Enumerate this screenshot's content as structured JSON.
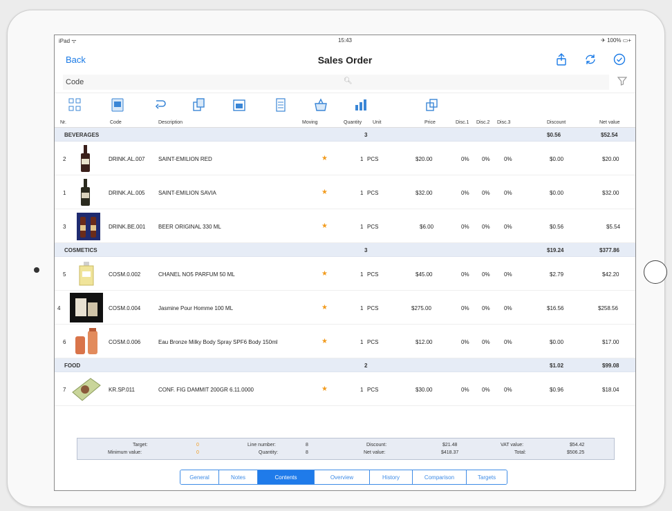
{
  "status": {
    "carrier": "iPad ᯤ",
    "time": "15:43",
    "battery": "✈ 100% ▭+"
  },
  "nav": {
    "back": "Back",
    "title": "Sales Order"
  },
  "search": {
    "value": "Code",
    "placeholder": "Code"
  },
  "columns": [
    "Nr.",
    "Code",
    "Description",
    "Moving",
    "Quantity",
    "Unit",
    "Price",
    "Disc.1",
    "Disc.2",
    "Disc.3",
    "Discount",
    "Net value"
  ],
  "groups": [
    {
      "name": "BEVERAGES",
      "qty": "3",
      "discount": "$0.56",
      "net": "$52.54"
    },
    {
      "name": "COSMETICS",
      "qty": "3",
      "discount": "$19.24",
      "net": "$377.86"
    },
    {
      "name": "FOOD",
      "qty": "2",
      "discount": "$1.02",
      "net": "$99.08"
    }
  ],
  "rows": [
    {
      "nr": "2",
      "code": "DRINK.AL.007",
      "desc": "SAINT-EMILION RED",
      "qty": "1",
      "unit": "PCS",
      "price": "$20.00",
      "d1": "0%",
      "d2": "0%",
      "d3": "0%",
      "discount": "$0.00",
      "net": "$20.00"
    },
    {
      "nr": "1",
      "code": "DRINK.AL.005",
      "desc": "SAINT-EMILION SAVIA",
      "qty": "1",
      "unit": "PCS",
      "price": "$32.00",
      "d1": "0%",
      "d2": "0%",
      "d3": "0%",
      "discount": "$0.00",
      "net": "$32.00"
    },
    {
      "nr": "3",
      "code": "DRINK.BE.001",
      "desc": "BEER ORIGINAL 330 ML",
      "qty": "1",
      "unit": "PCS",
      "price": "$6.00",
      "d1": "0%",
      "d2": "0%",
      "d3": "0%",
      "discount": "$0.56",
      "net": "$5.54"
    },
    {
      "nr": "5",
      "code": "COSM.0.002",
      "desc": "CHANEL NO5 PARFUM 50 ML",
      "qty": "1",
      "unit": "PCS",
      "price": "$45.00",
      "d1": "0%",
      "d2": "0%",
      "d3": "0%",
      "discount": "$2.79",
      "net": "$42.20"
    },
    {
      "nr": "4",
      "code": "COSM.0.004",
      "desc": "Jasmine Pour Homme 100 ML",
      "qty": "1",
      "unit": "PCS",
      "price": "$275.00",
      "d1": "0%",
      "d2": "0%",
      "d3": "0%",
      "discount": "$16.56",
      "net": "$258.56"
    },
    {
      "nr": "6",
      "code": "COSM.0.006",
      "desc": "Eau Bronze Milky Body Spray SPF6 Body 150ml",
      "qty": "1",
      "unit": "PCS",
      "price": "$12.00",
      "d1": "0%",
      "d2": "0%",
      "d3": "0%",
      "discount": "$0.00",
      "net": "$17.00"
    },
    {
      "nr": "7",
      "code": "KR.SP.011",
      "desc": "CONF. FIG DAMMIT 200GR 6.11.0000",
      "qty": "1",
      "unit": "PCS",
      "price": "$30.00",
      "d1": "0%",
      "d2": "0%",
      "d3": "0%",
      "discount": "$0.96",
      "net": "$18.04"
    }
  ],
  "summary": {
    "target_label": "Target:",
    "target_value": "0",
    "minimum_label": "Minimum value:",
    "minimum_value": "0",
    "lines_label": "Line number:",
    "lines_value": "8",
    "quantity_label": "Quantity:",
    "quantity_value": "8",
    "discount_label": "Discount:",
    "discount_value": "$21.48",
    "netvalue_label": "Net value:",
    "netvalue_value": "$418.37",
    "vat_label": "VAT value:",
    "vat_value": "$54.42",
    "total_label": "Total:",
    "total_value": "$506.25"
  },
  "tabs": [
    "General",
    "Notes",
    "Contents",
    "Overview",
    "History",
    "Comparison",
    "Targets"
  ],
  "active_tab": "Contents",
  "accent": "#1a7ae6"
}
